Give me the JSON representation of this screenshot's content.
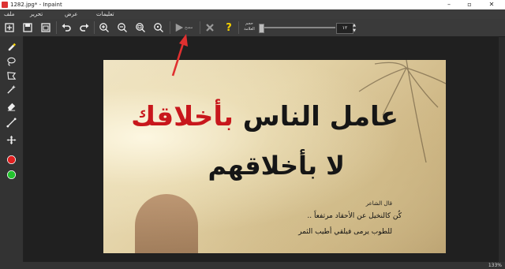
{
  "window": {
    "title": "1282.jpg* - Inpaint",
    "controls": [
      "minimize-icon",
      "maximize-icon",
      "close-icon"
    ]
  },
  "menu": {
    "file": "ملف",
    "edit": "تحرير",
    "view": "عرض",
    "guide": "تعليمات"
  },
  "toolbar": {
    "run_label": "مسح",
    "marker_size_label": "حجم العلامة",
    "marker_size_value": "١٢",
    "icons": [
      "open-icon",
      "save-icon",
      "save-as-icon",
      "undo-icon",
      "redo-icon",
      "zoom-in-icon",
      "zoom-out-icon",
      "zoom-fit-icon",
      "zoom-actual-icon",
      "play-icon",
      "cancel-x-icon",
      "help-question-icon"
    ]
  },
  "tools": [
    "marker-icon",
    "lasso-icon",
    "polygon-lasso-icon",
    "magic-wand-icon",
    "eraser-icon",
    "guide-line-icon",
    "move-icon",
    "red-color-icon",
    "green-color-icon"
  ],
  "colors": {
    "red": "#e02020",
    "green": "#22c22e",
    "help": "#f4d000",
    "arrow": "#e03030"
  },
  "image": {
    "line1_black": "عامل الناس ",
    "line1_red": "بأخلاقك",
    "line2": "لا بأخلاقهم",
    "poet": "قال الشاعر",
    "quote1": "كُن كالنخيل عن الأحقاد مرتفعاً ..",
    "quote2": "للطوب يرمى فيلقي أطيب الثمر"
  },
  "status": {
    "zoom": "133%"
  }
}
